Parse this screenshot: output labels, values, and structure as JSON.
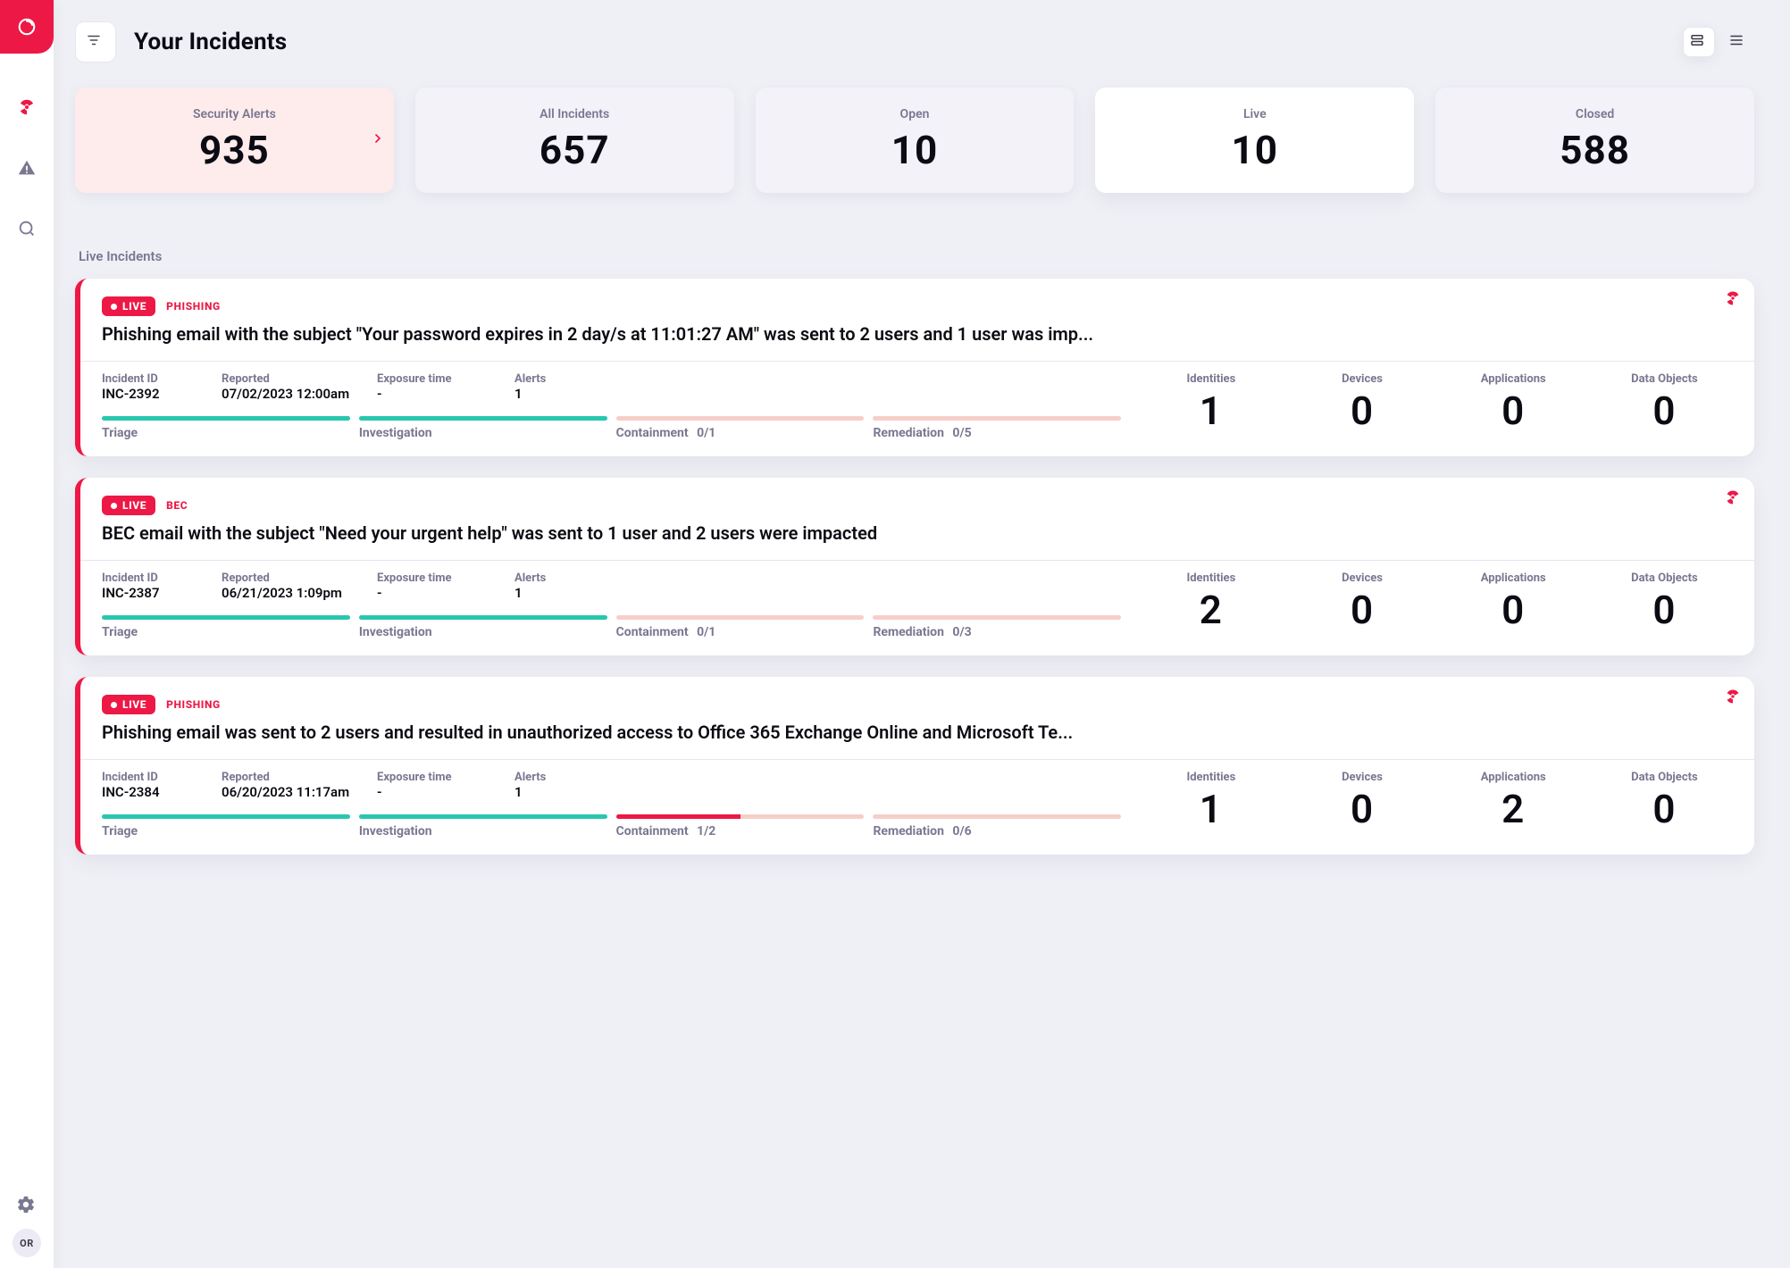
{
  "rail": {
    "avatarInitials": "OR",
    "nav": [
      {
        "name": "radiation",
        "active": true
      },
      {
        "name": "alerts",
        "active": false
      },
      {
        "name": "search",
        "active": false
      }
    ]
  },
  "page": {
    "title": "Your Incidents",
    "sectionTitle": "Live Incidents",
    "tiles": [
      {
        "label": "Security Alerts",
        "value": "935",
        "variant": "first"
      },
      {
        "label": "All Incidents",
        "value": "657",
        "variant": "default"
      },
      {
        "label": "Open",
        "value": "10",
        "variant": "default"
      },
      {
        "label": "Live",
        "value": "10",
        "variant": "elevated"
      },
      {
        "label": "Closed",
        "value": "588",
        "variant": "default"
      }
    ]
  },
  "labels": {
    "incidentId": "Incident ID",
    "reported": "Reported",
    "exposure": "Exposure time",
    "alerts": "Alerts",
    "identities": "Identities",
    "devices": "Devices",
    "applications": "Applications",
    "dataObjects": "Data Objects",
    "triage": "Triage",
    "investigation": "Investigation",
    "containment": "Containment",
    "remediation": "Remediation",
    "live": "LIVE"
  },
  "incidents": [
    {
      "tag": "PHISHING",
      "summary": "Phishing email with the subject \"Your password expires in 2 day/s at 11:01:27 AM\" was sent to 2 users and 1 user was imp...",
      "id": "INC-2392",
      "reported": "07/02/2023 12:00am",
      "exposure": "-",
      "alerts": "1",
      "identities": "1",
      "devices": "0",
      "applications": "0",
      "dataObjects": "0",
      "phases": {
        "triage": {
          "fill": 100,
          "warn": false,
          "count": ""
        },
        "investigation": {
          "fill": 100,
          "warn": false,
          "count": ""
        },
        "containment": {
          "fill": 0,
          "warn": false,
          "count": "0/1"
        },
        "remediation": {
          "fill": 0,
          "warn": false,
          "count": "0/5"
        }
      }
    },
    {
      "tag": "BEC",
      "summary": "BEC email with the subject \"Need your urgent help\" was sent to 1 user and 2 users were impacted",
      "id": "INC-2387",
      "reported": "06/21/2023 1:09pm",
      "exposure": "-",
      "alerts": "1",
      "identities": "2",
      "devices": "0",
      "applications": "0",
      "dataObjects": "0",
      "phases": {
        "triage": {
          "fill": 100,
          "warn": false,
          "count": ""
        },
        "investigation": {
          "fill": 100,
          "warn": false,
          "count": ""
        },
        "containment": {
          "fill": 0,
          "warn": false,
          "count": "0/1"
        },
        "remediation": {
          "fill": 0,
          "warn": false,
          "count": "0/3"
        }
      }
    },
    {
      "tag": "PHISHING",
      "summary": "Phishing email was sent to 2 users and resulted in unauthorized access to Office 365 Exchange Online and Microsoft Te...",
      "id": "INC-2384",
      "reported": "06/20/2023 11:17am",
      "exposure": "-",
      "alerts": "1",
      "identities": "1",
      "devices": "0",
      "applications": "2",
      "dataObjects": "0",
      "phases": {
        "triage": {
          "fill": 100,
          "warn": false,
          "count": ""
        },
        "investigation": {
          "fill": 100,
          "warn": false,
          "count": ""
        },
        "containment": {
          "fill": 50,
          "warn": true,
          "count": "1/2"
        },
        "remediation": {
          "fill": 0,
          "warn": false,
          "count": "0/6"
        }
      }
    }
  ]
}
